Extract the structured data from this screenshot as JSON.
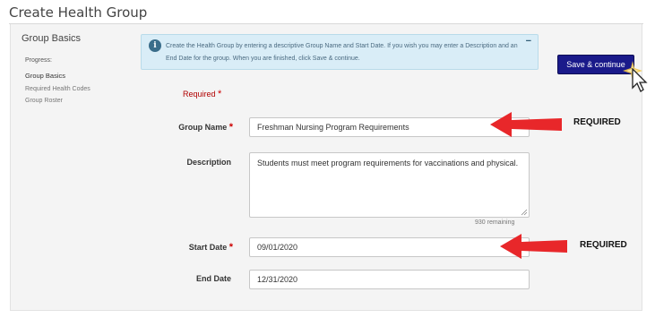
{
  "page": {
    "title": "Create Health Group"
  },
  "sidebar": {
    "heading": "Group Basics",
    "progress_label": "Progress:",
    "steps": [
      {
        "label": "Group Basics",
        "active": true
      },
      {
        "label": "Required Health Codes",
        "active": false
      },
      {
        "label": "Group Roster",
        "active": false
      }
    ]
  },
  "info": {
    "icon": "info-icon",
    "text": "Create the Health Group by entering a descriptive Group Name and Start Date. If you wish you may enter a Description and an End Date for the group. When you are finished, click Save & continue.",
    "collapse": "−"
  },
  "toolbar": {
    "save_label": "Save & continue"
  },
  "form": {
    "required_note": "Required",
    "required_marker": "*",
    "group_name": {
      "label": "Group Name",
      "value": "Freshman Nursing Program Requirements"
    },
    "description": {
      "label": "Description",
      "value": "Students must meet program requirements for vaccinations and physical.",
      "remaining": "930 remaining"
    },
    "start_date": {
      "label": "Start Date",
      "value": "09/01/2020"
    },
    "end_date": {
      "label": "End Date",
      "value": "12/31/2020"
    }
  },
  "annotations": {
    "arrow_color": "#e8272a",
    "group_name_note": "REQUIRED",
    "start_date_note": "REQUIRED"
  },
  "colors": {
    "save_button": "#1a1a8a",
    "info_background": "#d9edf7",
    "required_red": "#cc0000"
  }
}
